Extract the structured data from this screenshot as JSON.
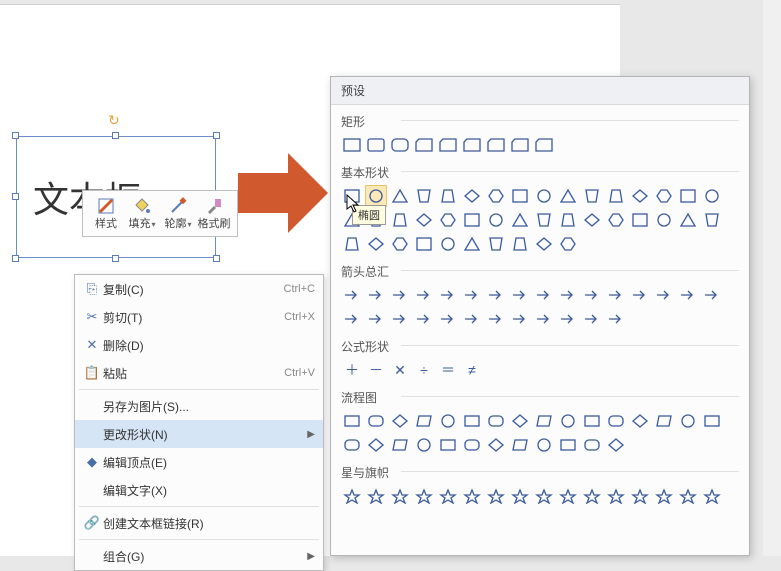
{
  "textbox": {
    "content": "文本框"
  },
  "mini_toolbar": [
    {
      "label": "样式",
      "icon": "style"
    },
    {
      "label": "填充",
      "icon": "fill",
      "dropdown": true
    },
    {
      "label": "轮廓",
      "icon": "outline",
      "dropdown": true
    },
    {
      "label": "格式刷",
      "icon": "brush"
    }
  ],
  "context_menu": [
    {
      "label": "复制(C)",
      "icon": "copy",
      "shortcut": "Ctrl+C"
    },
    {
      "label": "剪切(T)",
      "icon": "cut",
      "shortcut": "Ctrl+X"
    },
    {
      "label": "删除(D)",
      "icon": "delete"
    },
    {
      "label": "粘贴",
      "icon": "paste",
      "shortcut": "Ctrl+V"
    },
    {
      "sep": true
    },
    {
      "label": "另存为图片(S)..."
    },
    {
      "label": "更改形状(N)",
      "submenu": true,
      "highlight": true
    },
    {
      "label": "编辑顶点(E)",
      "icon": "vertex"
    },
    {
      "label": "编辑文字(X)"
    },
    {
      "sep": true
    },
    {
      "label": "创建文本框链接(R)",
      "icon": "link"
    },
    {
      "sep": true
    },
    {
      "label": "组合(G)",
      "submenu": true
    }
  ],
  "shape_panel": {
    "title": "预设",
    "tooltip": "椭圆",
    "categories": [
      {
        "name": "矩形",
        "count": 9
      },
      {
        "name": "基本形状",
        "count": 42
      },
      {
        "name": "箭头总汇",
        "count": 28
      },
      {
        "name": "公式形状",
        "count": 6
      },
      {
        "name": "流程图",
        "count": 28
      },
      {
        "name": "星与旗帜",
        "count": 16
      }
    ]
  }
}
